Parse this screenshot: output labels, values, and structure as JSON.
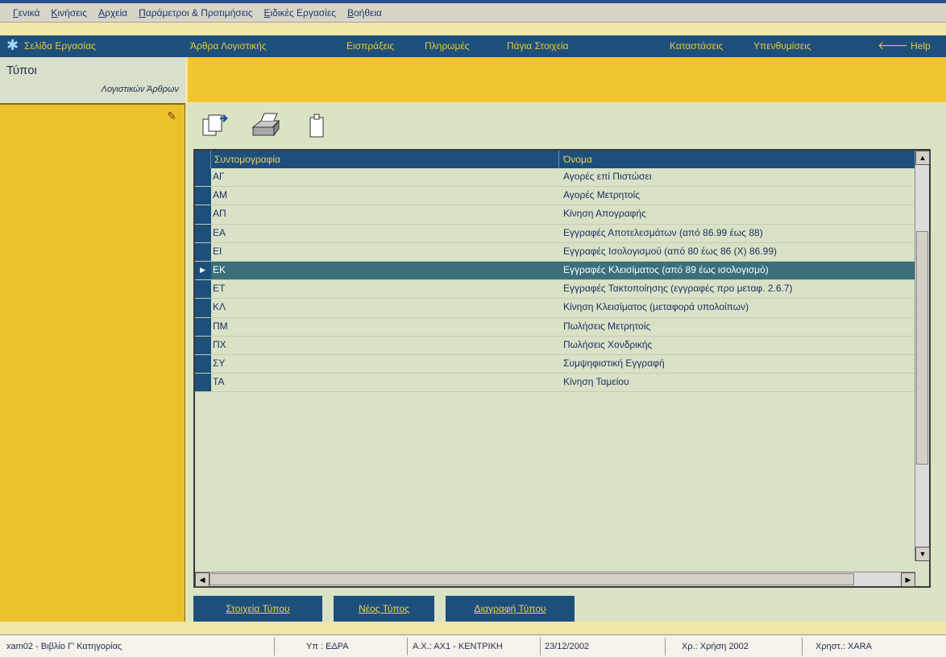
{
  "menubar": {
    "items": [
      "Γενικά",
      "Κινήσεις",
      "Αρχεία",
      "Παράμετροι & Προτιμήσεις",
      "Ειδικές Εργασίες",
      "Βοήθεια"
    ]
  },
  "navbar": {
    "items": [
      {
        "label": "Σελίδα Εργασίας"
      },
      {
        "label": "Άρθρα Λογιστικής"
      },
      {
        "label": "Εισπράξεις"
      },
      {
        "label": "Πληρωμές"
      },
      {
        "label": "Πάγια Στοιχεία"
      },
      {
        "label": "Καταστάσεις"
      },
      {
        "label": "Υπενθυμίσεις"
      },
      {
        "label": "Help"
      }
    ],
    "back_icon": "left-arrow-icon"
  },
  "left_header": {
    "title": "Τύποι",
    "subtitle": "Λογιστικών Άρθρων"
  },
  "toolbar": {
    "icons": [
      "new-document-icon",
      "print-icon",
      "clipboard-icon"
    ]
  },
  "grid": {
    "columns": [
      "Συντομογραφία",
      "Όνομα"
    ],
    "rows": [
      {
        "code": "ΑΓ",
        "name": "Αγορές επί Πιστώσει"
      },
      {
        "code": "ΑΜ",
        "name": "Αγορές Μετρητοίς"
      },
      {
        "code": "ΑΠ",
        "name": "Κίνηση Απογραφής"
      },
      {
        "code": "ΕΑ",
        "name": "Εγγραφές Αποτελεσμάτων (από 86.99 έως 88)"
      },
      {
        "code": "ΕΙ",
        "name": "Εγγραφές Ισολογισμού (από 80 έως 86 (Χ) 86.99)"
      },
      {
        "code": "ΕΚ",
        "name": "Εγγραφές Κλεισίματος (από 89 έως ισολογισμό)"
      },
      {
        "code": "ΕΤ",
        "name": "Εγγραφές Τακτοποίησης (εγγραφές προ μεταφ. 2.6.7)"
      },
      {
        "code": "ΚΛ",
        "name": "Κίνηση Κλεισίματος (μεταφορά υπολοίπων)"
      },
      {
        "code": "ΠΜ",
        "name": "Πωλήσεις Μετρητοίς"
      },
      {
        "code": "ΠΧ",
        "name": "Πωλήσεις Χονδρικής"
      },
      {
        "code": "ΣΥ",
        "name": "Συμψηφιστική Εγγραφή"
      },
      {
        "code": "ΤΑ",
        "name": "Κίνηση Ταμείου"
      }
    ],
    "selected_index": 5
  },
  "buttons": {
    "details": "Στοιχεία Τύπου",
    "new": "Νέος Τύπος",
    "delete": "Διαγραφή Τύπου"
  },
  "statusbar": {
    "company": "xam02 - Βιβλίο Γ' Κατηγορίας",
    "branch_user": "Υπ : ΕΔΡΑ",
    "ax": "Α.Χ.: ΑΧ1 - ΚΕΝΤΡΙΚΗ",
    "date": "23/12/2002",
    "year": "Χρ.: Χρήση 2002",
    "user": "Χρηστ.: XARA"
  }
}
